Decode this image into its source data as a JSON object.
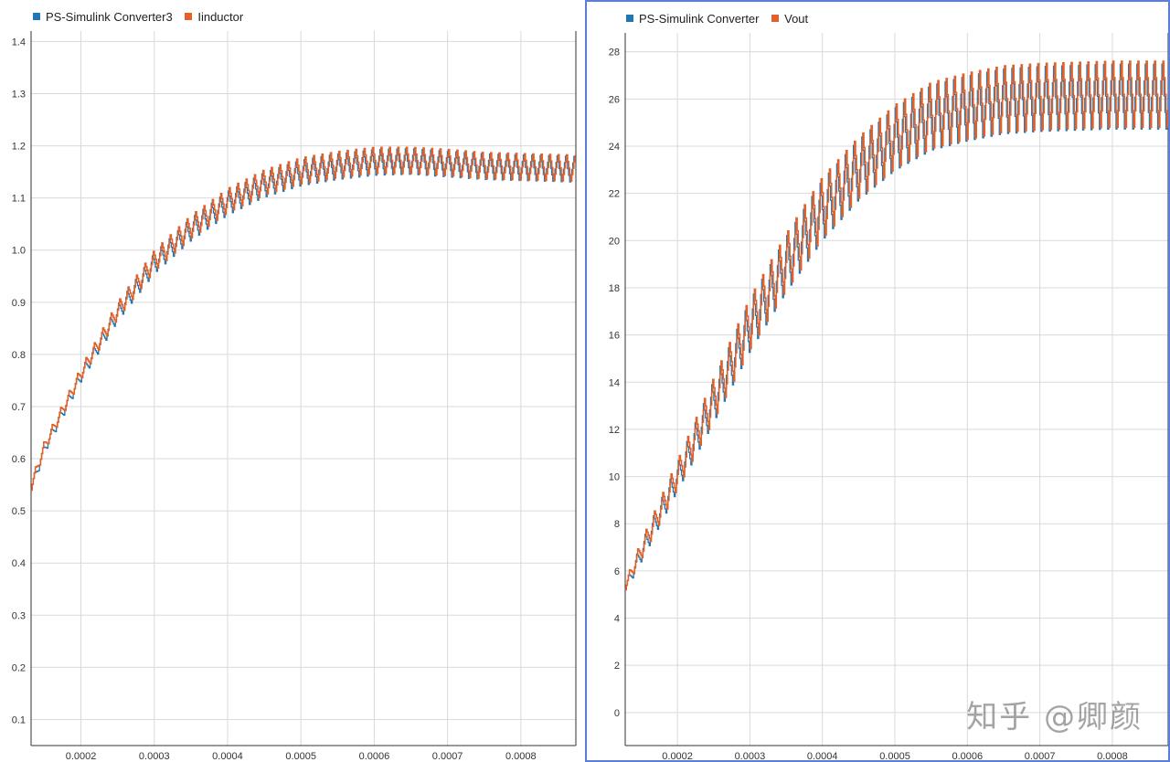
{
  "chart_data": [
    {
      "type": "line",
      "title": "",
      "xlabel": "",
      "ylabel": "",
      "xlim": [
        0.000132,
        0.000875
      ],
      "ylim": [
        0.05,
        1.42
      ],
      "grid": true,
      "legend_position": "top-left",
      "x_ticks": [
        "0.0002",
        "0.0003",
        "0.0004",
        "0.0005",
        "0.0006",
        "0.0007",
        "0.0008"
      ],
      "y_ticks": [
        "0.1",
        "0.2",
        "0.3",
        "0.4",
        "0.5",
        "0.6",
        "0.7",
        "0.8",
        "0.9",
        "1.0",
        "1.1",
        "1.2",
        "1.3",
        "1.4"
      ],
      "ripple_period": 1.15e-05,
      "series": [
        {
          "name": "PS-Simulink Converter3",
          "color": "#1f77b4",
          "envelope_x": [
            0.000132,
            0.00015,
            0.0002,
            0.00025,
            0.0003,
            0.00035,
            0.0004,
            0.00045,
            0.0005,
            0.00055,
            0.0006,
            0.00065,
            0.0007,
            0.00075,
            0.0008,
            0.000875
          ],
          "envelope_y": [
            0.545,
            0.62,
            0.76,
            0.88,
            0.975,
            1.04,
            1.09,
            1.125,
            1.148,
            1.16,
            1.168,
            1.17,
            1.165,
            1.16,
            1.158,
            1.155
          ],
          "ripple_amplitude": [
            0.01,
            0.01,
            0.012,
            0.016,
            0.02,
            0.022,
            0.023,
            0.024,
            0.025,
            0.025,
            0.025,
            0.025,
            0.025,
            0.025,
            0.025,
            0.025
          ]
        },
        {
          "name": "Iinductor",
          "color": "#e0612a",
          "envelope_x": [
            0.000132,
            0.00015,
            0.0002,
            0.00025,
            0.0003,
            0.00035,
            0.0004,
            0.00045,
            0.0005,
            0.00055,
            0.0006,
            0.00065,
            0.0007,
            0.00075,
            0.0008,
            0.000875
          ],
          "envelope_y": [
            0.55,
            0.625,
            0.765,
            0.885,
            0.98,
            1.045,
            1.095,
            1.13,
            1.152,
            1.164,
            1.172,
            1.172,
            1.168,
            1.162,
            1.16,
            1.157
          ],
          "ripple_amplitude": [
            0.01,
            0.01,
            0.012,
            0.016,
            0.02,
            0.022,
            0.023,
            0.024,
            0.025,
            0.025,
            0.025,
            0.025,
            0.025,
            0.025,
            0.025,
            0.025
          ]
        }
      ]
    },
    {
      "type": "line",
      "title": "",
      "xlabel": "",
      "ylabel": "",
      "xlim": [
        0.000128,
        0.000877
      ],
      "ylim": [
        -1.4,
        28.8
      ],
      "grid": true,
      "legend_position": "top-left",
      "x_ticks": [
        "0.0002",
        "0.0003",
        "0.0004",
        "0.0005",
        "0.0006",
        "0.0007",
        "0.0008"
      ],
      "y_ticks": [
        "0",
        "2",
        "4",
        "6",
        "8",
        "10",
        "12",
        "14",
        "16",
        "18",
        "20",
        "22",
        "24",
        "26",
        "28"
      ],
      "ripple_period": 1.15e-05,
      "series": [
        {
          "name": "PS-Simulink Converter",
          "color": "#1f77b4",
          "envelope_x": [
            0.000128,
            0.00015,
            0.0002,
            0.00025,
            0.0003,
            0.00035,
            0.0004,
            0.00045,
            0.0005,
            0.00055,
            0.0006,
            0.00065,
            0.0007,
            0.00075,
            0.0008,
            0.000877
          ],
          "envelope_y": [
            5.3,
            6.8,
            10.0,
            13.2,
            16.4,
            19.0,
            21.3,
            23.0,
            24.3,
            25.2,
            25.6,
            25.9,
            26.0,
            26.05,
            26.1,
            26.1
          ],
          "ripple_amplitude": [
            0.2,
            0.4,
            0.6,
            0.9,
            1.1,
            1.2,
            1.3,
            1.3,
            1.35,
            1.4,
            1.4,
            1.4,
            1.4,
            1.4,
            1.4,
            1.4
          ]
        },
        {
          "name": "Vout",
          "color": "#e0612a",
          "envelope_x": [
            0.000128,
            0.00015,
            0.0002,
            0.00025,
            0.0003,
            0.00035,
            0.0004,
            0.00045,
            0.0005,
            0.00055,
            0.0006,
            0.00065,
            0.0007,
            0.00075,
            0.0008,
            0.000877
          ],
          "envelope_y": [
            5.4,
            6.9,
            10.1,
            13.3,
            16.5,
            19.1,
            21.4,
            23.1,
            24.4,
            25.3,
            25.7,
            26.0,
            26.1,
            26.15,
            26.2,
            26.2
          ],
          "ripple_amplitude": [
            0.2,
            0.4,
            0.6,
            0.9,
            1.1,
            1.2,
            1.3,
            1.3,
            1.35,
            1.4,
            1.4,
            1.4,
            1.4,
            1.4,
            1.4,
            1.4
          ]
        }
      ]
    }
  ],
  "legend_left": {
    "series1": "PS-Simulink Converter3",
    "series2": "Iinductor"
  },
  "legend_right": {
    "series1": "PS-Simulink Converter",
    "series2": "Vout"
  },
  "colors": {
    "series_blue": "#1f77b4",
    "series_orange": "#e0612a",
    "grid": "#d9d9d9",
    "axis": "#333333",
    "selected_border": "#5b7fd6"
  },
  "watermark": "知乎 @卿颜"
}
